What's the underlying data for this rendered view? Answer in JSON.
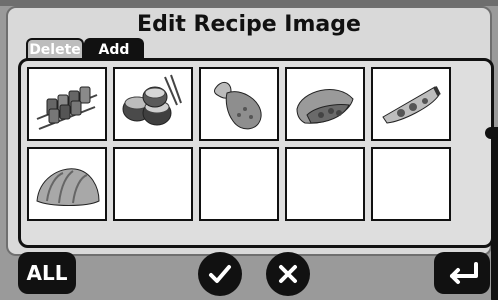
{
  "title": "Edit Recipe Image",
  "tabs": [
    {
      "label": "Delete",
      "active": false
    },
    {
      "label": "Add",
      "active": true
    }
  ],
  "grid": {
    "items": [
      {
        "icon": "kebab-icon"
      },
      {
        "icon": "takoyaki-icon"
      },
      {
        "icon": "chicken-leg-icon"
      },
      {
        "icon": "flatbread-wrap-icon"
      },
      {
        "icon": "pizza-slice-icon"
      },
      {
        "icon": "croissant-icon"
      },
      {
        "icon": "empty-slot"
      },
      {
        "icon": "empty-slot"
      },
      {
        "icon": "empty-slot"
      },
      {
        "icon": "empty-slot"
      }
    ]
  },
  "footer": {
    "all_label": "ALL"
  }
}
